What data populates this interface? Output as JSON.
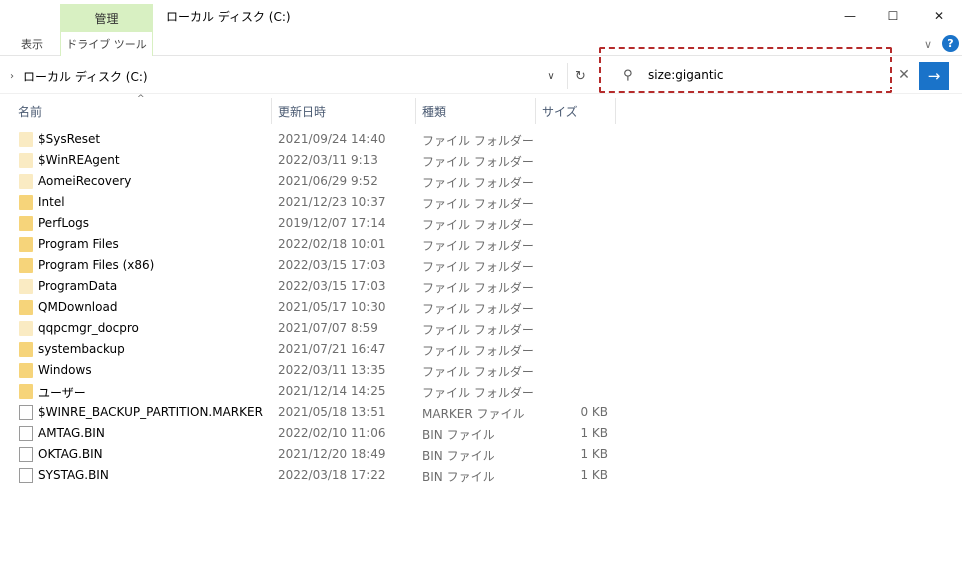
{
  "window": {
    "title": "ローカル ディスク (C:)",
    "manage_tab": "管理",
    "drive_tools_tab": "ドライブ ツール",
    "view_tab": "表示",
    "minimize": "—",
    "maximize": "☐",
    "close": "✕",
    "help": "?",
    "ribbon_expand": "∨"
  },
  "address": {
    "path": "ローカル ディスク (C:)",
    "chevron": "›",
    "dropdown": "∨",
    "refresh": "↻"
  },
  "search": {
    "value": "size:gigantic",
    "icon": "⚲",
    "clear": "✕",
    "go": "→"
  },
  "columns": {
    "name": "名前",
    "date": "更新日時",
    "type": "種類",
    "size": "サイズ",
    "sort_indicator": "^"
  },
  "files": [
    {
      "name": "$SysReset",
      "date": "2021/09/24 14:40",
      "type": "ファイル フォルダー",
      "size": "",
      "kind": "folder-light"
    },
    {
      "name": "$WinREAgent",
      "date": "2022/03/11 9:13",
      "type": "ファイル フォルダー",
      "size": "",
      "kind": "folder-light"
    },
    {
      "name": "AomeiRecovery",
      "date": "2021/06/29 9:52",
      "type": "ファイル フォルダー",
      "size": "",
      "kind": "folder-light"
    },
    {
      "name": "Intel",
      "date": "2021/12/23 10:37",
      "type": "ファイル フォルダー",
      "size": "",
      "kind": "folder"
    },
    {
      "name": "PerfLogs",
      "date": "2019/12/07 17:14",
      "type": "ファイル フォルダー",
      "size": "",
      "kind": "folder"
    },
    {
      "name": "Program Files",
      "date": "2022/02/18 10:01",
      "type": "ファイル フォルダー",
      "size": "",
      "kind": "folder"
    },
    {
      "name": "Program Files (x86)",
      "date": "2022/03/15 17:03",
      "type": "ファイル フォルダー",
      "size": "",
      "kind": "folder"
    },
    {
      "name": "ProgramData",
      "date": "2022/03/15 17:03",
      "type": "ファイル フォルダー",
      "size": "",
      "kind": "folder-light"
    },
    {
      "name": "QMDownload",
      "date": "2021/05/17 10:30",
      "type": "ファイル フォルダー",
      "size": "",
      "kind": "folder"
    },
    {
      "name": "qqpcmgr_docpro",
      "date": "2021/07/07 8:59",
      "type": "ファイル フォルダー",
      "size": "",
      "kind": "folder-light"
    },
    {
      "name": "systembackup",
      "date": "2021/07/21 16:47",
      "type": "ファイル フォルダー",
      "size": "",
      "kind": "folder"
    },
    {
      "name": "Windows",
      "date": "2022/03/11 13:35",
      "type": "ファイル フォルダー",
      "size": "",
      "kind": "folder"
    },
    {
      "name": "ユーザー",
      "date": "2021/12/14 14:25",
      "type": "ファイル フォルダー",
      "size": "",
      "kind": "folder"
    },
    {
      "name": "$WINRE_BACKUP_PARTITION.MARKER",
      "date": "2021/05/18 13:51",
      "type": "MARKER ファイル",
      "size": "0 KB",
      "kind": "file"
    },
    {
      "name": "AMTAG.BIN",
      "date": "2022/02/10 11:06",
      "type": "BIN ファイル",
      "size": "1 KB",
      "kind": "file"
    },
    {
      "name": "OKTAG.BIN",
      "date": "2021/12/20 18:49",
      "type": "BIN ファイル",
      "size": "1 KB",
      "kind": "file"
    },
    {
      "name": "SYSTAG.BIN",
      "date": "2022/03/18 17:22",
      "type": "BIN ファイル",
      "size": "1 KB",
      "kind": "file"
    }
  ],
  "colors": {
    "manage_tab_bg": "#d8f0c2",
    "search_outline": "#b52b2b",
    "accent_blue": "#1a73c9",
    "folder": "#f6d47a"
  }
}
